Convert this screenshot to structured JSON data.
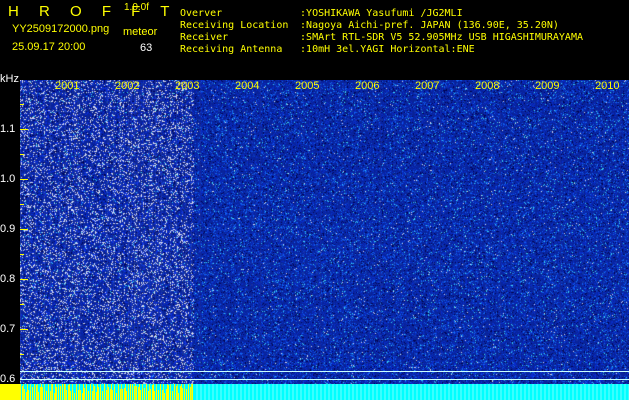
{
  "header": {
    "brand": "H R O F F T",
    "version": "1.0.0f",
    "filename": "YY2509172000.png",
    "datetime": "25.09.17 20:00",
    "mode": "meteor",
    "count": "63",
    "info": [
      {
        "label": "Overver",
        "value": ":YOSHIKAWA Yasufumi /JG2MLI"
      },
      {
        "label": "Receiving Location",
        "value": ":Nagoya Aichi-pref. JAPAN (136.90E, 35.20N)"
      },
      {
        "label": "Receiver",
        "value": ":SMArt RTL-SDR V5 52.905MHz USB HIGASHIMURAYAMA"
      },
      {
        "label": "Receiving Antenna",
        "value": ":10mH 3el.YAGI Horizontal:ENE"
      }
    ]
  },
  "spectrogram": {
    "y_unit": "kHz",
    "frequency_labels": [
      "1.1",
      "1.0",
      "0.9",
      "0.8",
      "0.7",
      "0.6"
    ],
    "minute_labels": [
      "2001",
      "2002",
      "2003",
      "2004",
      "2005",
      "2006",
      "2007",
      "2008",
      "2009",
      "2010"
    ],
    "colors": {
      "background": "#000000",
      "header_text": "#ffff00",
      "label_text": "#ffffff",
      "noise_primary": "#0d2eb8",
      "noise_cyan": "#5affff",
      "guide_line": "#c9ffff",
      "bottom_bar": "#00ffff",
      "bottom_accent": "#ffff00"
    }
  }
}
